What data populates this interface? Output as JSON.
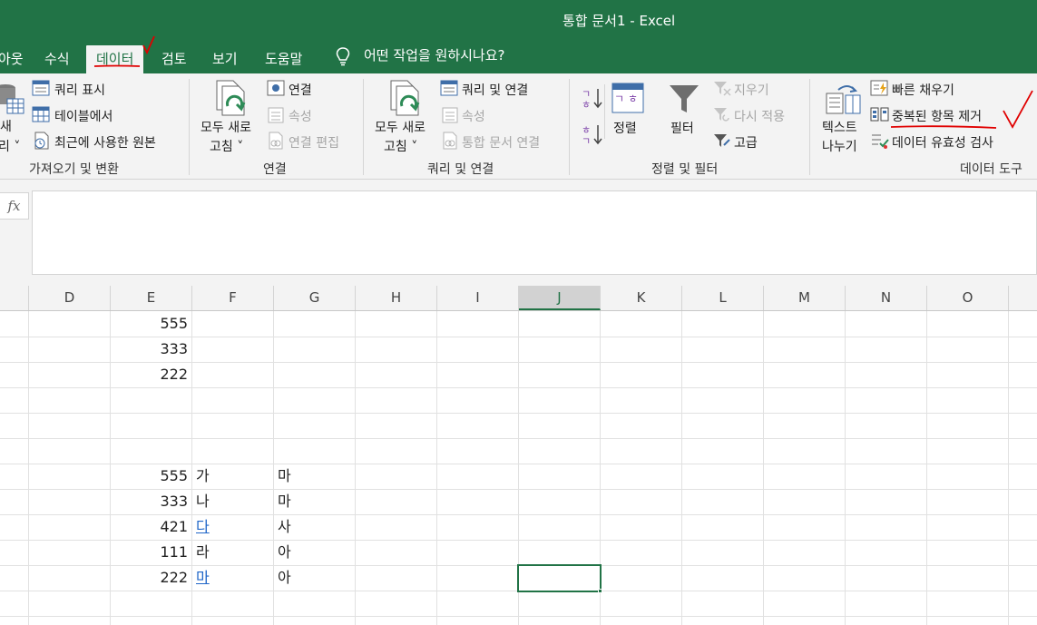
{
  "window": {
    "title": "통합 문서1  -  Excel"
  },
  "tabs": {
    "partial": "아웃",
    "formulas": "수식",
    "data": "데이터",
    "review": "검토",
    "view": "보기",
    "help": "도움말",
    "tell_me": "어떤 작업을 원하시나요?"
  },
  "ribbon": {
    "get_transform": {
      "new_query_partial_1": "새",
      "new_query_partial_2": "리 ˅",
      "show_queries": "쿼리 표시",
      "from_table": "테이블에서",
      "recent_sources": "최근에 사용한 원본",
      "label": "가져오기 및 변환"
    },
    "connections": {
      "refresh_all_1": "모두 새로",
      "refresh_all_2": "고침 ˅",
      "connections": "연결",
      "properties": "속성",
      "edit_links": "연결 편집",
      "label": "연결"
    },
    "queries": {
      "refresh_all_1": "모두 새로",
      "refresh_all_2": "고침 ˅",
      "queries_connections": "쿼리 및 연결",
      "properties": "속성",
      "edit_links": "통합 문서 연결",
      "label": "쿼리 및 연결"
    },
    "sort_filter": {
      "sort": "정렬",
      "filter": "필터",
      "clear": "지우기",
      "reapply": "다시 적용",
      "advanced": "고급",
      "label": "정렬 및 필터"
    },
    "data_tools": {
      "text_to_columns_1": "텍스트",
      "text_to_columns_2": "나누기",
      "flash_fill": "빠른 채우기",
      "remove_duplicates": "중복된 항목 제거",
      "data_validation": "데이터 유효성 검사",
      "label": "데이터 도구"
    }
  },
  "formula_bar": {
    "fx": "fx",
    "value": ""
  },
  "columns": [
    "D",
    "E",
    "F",
    "G",
    "H",
    "I",
    "J",
    "K",
    "L",
    "M",
    "N",
    "O"
  ],
  "selected_column": "J",
  "cells": {
    "r1": {
      "e": "555"
    },
    "r2": {
      "e": "333"
    },
    "r3": {
      "e": "222"
    },
    "r7": {
      "e": "555",
      "f": "가",
      "g": "마"
    },
    "r8": {
      "e": "333",
      "f": "나",
      "g": "마"
    },
    "r9": {
      "e": "421",
      "f": "다",
      "g": "사"
    },
    "r10": {
      "e": "111",
      "f": "라",
      "g": "아"
    },
    "r11": {
      "e": "222",
      "f": "마",
      "g": "아"
    }
  },
  "colors": {
    "excel_green": "#217346",
    "link": "#1f66c8",
    "annotation": "#e00000"
  }
}
